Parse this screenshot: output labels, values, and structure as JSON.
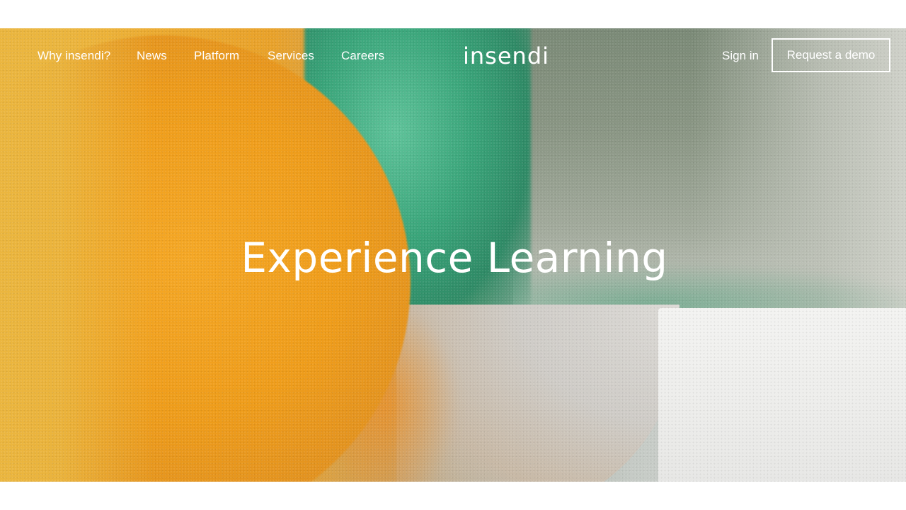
{
  "nav": {
    "links": [
      "Why insendi?",
      "News",
      "Platform",
      "Services",
      "Careers"
    ],
    "logo": "insendi",
    "sign_in": "Sign in",
    "cta": "Request a demo"
  },
  "hero": {
    "headline": "Experience Learning"
  },
  "colors": {
    "text": "#ffffff",
    "orange": "#ef9d1b",
    "green": "#3aa57a",
    "grey": "#8a9684"
  }
}
